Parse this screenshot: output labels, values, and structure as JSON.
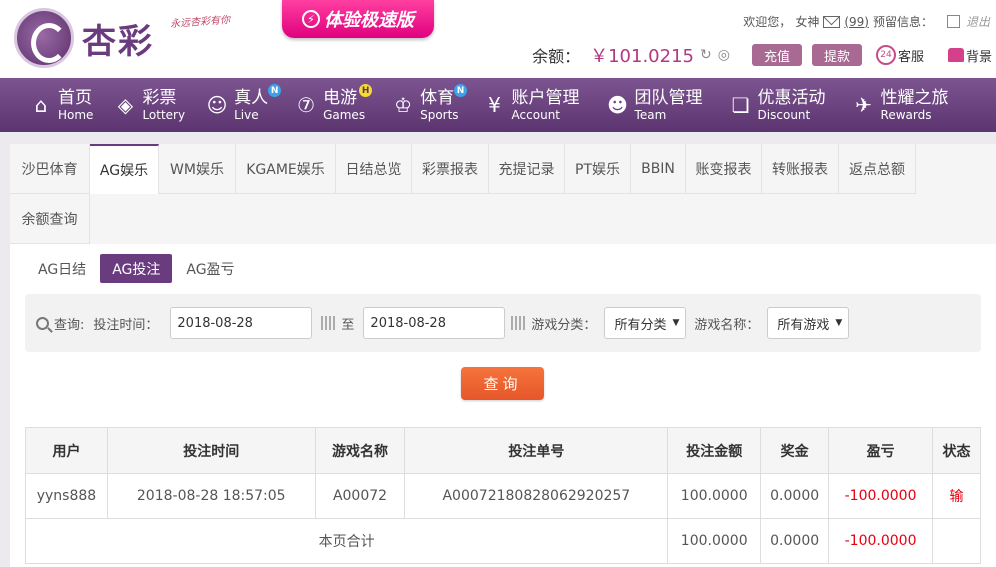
{
  "header": {
    "brand": "杏彩",
    "slogan": "永远杏彩有你",
    "promo_label": "体验极速版",
    "welcome": "欢迎您，",
    "username": "女神",
    "message_count": "(99)",
    "notice_label": "预留信息：",
    "logout_label": "退出",
    "balance_label": "余额：",
    "balance_value": "￥101.0215",
    "deposit_label": "充值",
    "withdraw_label": "提款",
    "service_label": "客服",
    "background_label": "背景"
  },
  "nav": [
    {
      "cn": "首页",
      "en": "Home",
      "icon": "home-icon"
    },
    {
      "cn": "彩票",
      "en": "Lottery",
      "icon": "lottery-icon"
    },
    {
      "cn": "真人",
      "en": "Live",
      "icon": "live-icon",
      "badge": "N"
    },
    {
      "cn": "电游",
      "en": "Games",
      "icon": "games-icon",
      "badge": "H"
    },
    {
      "cn": "体育",
      "en": "Sports",
      "icon": "sports-icon",
      "badge": "N"
    },
    {
      "cn": "账户管理",
      "en": "Account",
      "icon": "account-icon"
    },
    {
      "cn": "团队管理",
      "en": "Team",
      "icon": "team-icon"
    },
    {
      "cn": "优惠活动",
      "en": "Discount",
      "icon": "gift-icon"
    },
    {
      "cn": "性耀之旅",
      "en": "Rewards",
      "icon": "rewards-icon"
    }
  ],
  "tabs": [
    "沙巴体育",
    "AG娱乐",
    "WM娱乐",
    "KGAME娱乐",
    "日结总览",
    "彩票报表",
    "充提记录",
    "PT娱乐",
    "BBIN",
    "账变报表",
    "转账报表",
    "返点总额",
    "余额查询"
  ],
  "active_tab": "AG娱乐",
  "subtabs": [
    "AG日结",
    "AG投注",
    "AG盈亏"
  ],
  "active_subtab": "AG投注",
  "filter": {
    "query_label": "查询:",
    "time_label": "投注时间：",
    "start_date": "2018-08-28",
    "to_label": "至",
    "end_date": "2018-08-28",
    "category_label": "游戏分类：",
    "category_value": "所有分类",
    "game_label": "游戏名称：",
    "game_value": "所有游戏"
  },
  "query_button": "查询",
  "table": {
    "headers": [
      "用户",
      "投注时间",
      "游戏名称",
      "投注单号",
      "投注金额",
      "奖金",
      "盈亏",
      "状态"
    ],
    "rows": [
      {
        "user": "yyns888",
        "time": "2018-08-28 18:57:05",
        "game": "A00072",
        "bet_no": "A00072180828062920257",
        "amount": "100.0000",
        "bonus": "0.0000",
        "profit": "-100.0000",
        "status": "输"
      }
    ],
    "total": {
      "label": "本页合计",
      "amount": "100.0000",
      "bonus": "0.0000",
      "profit": "-100.0000"
    }
  },
  "colors": {
    "primary": "#6b3b7f",
    "accent": "#e6562a",
    "negative": "#e60012",
    "balance": "#b3397f"
  }
}
